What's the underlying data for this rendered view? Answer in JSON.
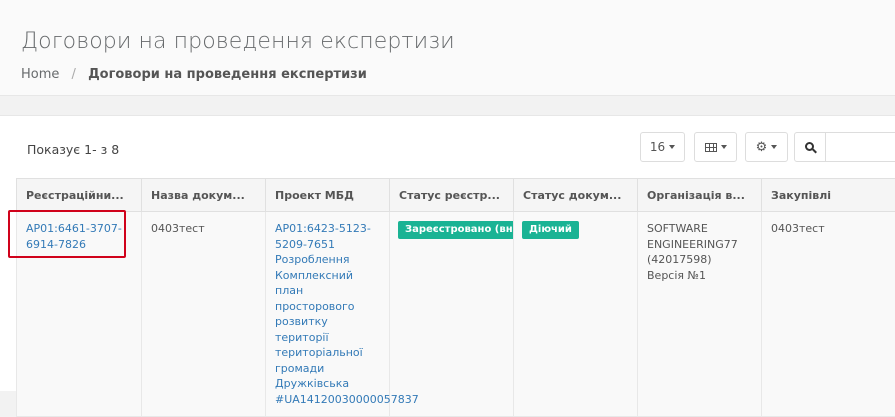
{
  "header": {
    "title": "Договори на проведення експертизи",
    "breadcrumb": {
      "home": "Home",
      "separator": "/",
      "current": "Договори на проведення експертизи"
    }
  },
  "toolbar": {
    "showing_text": "Показує 1- з 8",
    "page_size": "16"
  },
  "table": {
    "columns": [
      "Реєстраційни...",
      "Назва докум...",
      "Проект МБД",
      "Статус реєстр...",
      "Статус докум...",
      "Організація в...",
      "Закупівлі"
    ],
    "rows": [
      {
        "reg_number": "АР01:6461-3707-6914-7826",
        "doc_name": "0403тест",
        "project_mbd": "АР01:6423-5123-5209-7651 Розроблення Комплексний план просторового розвитку території територіальної громади Дружківська #UA14120030000057837",
        "reg_status": "Зареєстровано (внесено)",
        "doc_status": "Діючий",
        "organization": "SOFTWARE ENGINEERING77 (42017598) Версія №1",
        "procurement": "0403тест"
      }
    ]
  },
  "colors": {
    "accent_link": "#337ab7",
    "badge_teal": "#1ab394",
    "highlight": "#d0021b"
  },
  "icons": [
    "grid-icon",
    "gear-icon",
    "search-icon",
    "chevron-down-icon"
  ]
}
